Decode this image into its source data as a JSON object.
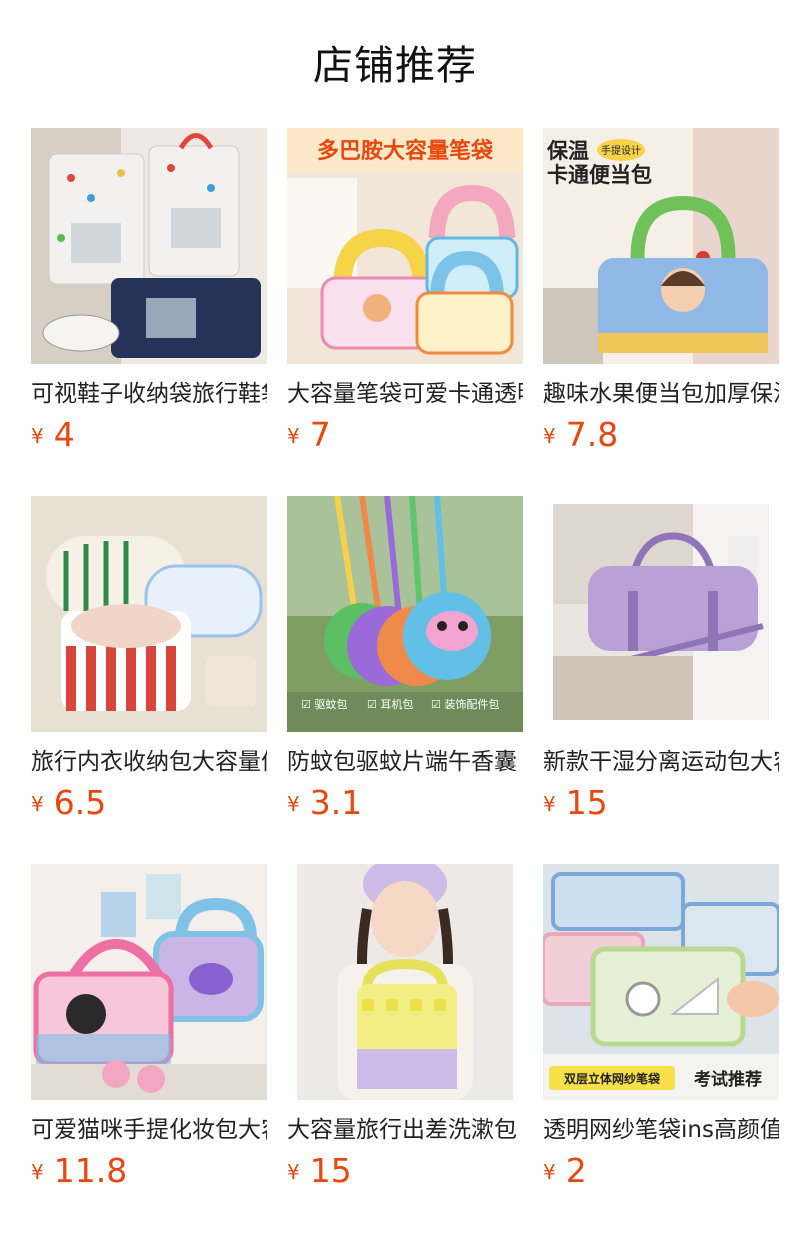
{
  "header": {
    "title": "店铺推荐"
  },
  "currency_symbol": "¥",
  "products": [
    {
      "name": "可视鞋子收纳袋旅行鞋袋",
      "price": "4",
      "image": "shoe-bag-photo",
      "colors": {
        "bg": "#eee9e3",
        "a": "#f3f1f0",
        "b": "#263257",
        "c": "#e0463c"
      }
    },
    {
      "name": "大容量笔袋可爱卡通透明",
      "price": "7",
      "image": "pencil-case-photo",
      "overlay_text": "多巴胺大容量笔袋",
      "colors": {
        "bg": "#f2e6d8",
        "a": "#f5d447",
        "b": "#f28a3a",
        "c": "#7bc3e8"
      }
    },
    {
      "name": "趣味水果便当包加厚保温",
      "price": "7.8",
      "overlay_text_1": "保温",
      "overlay_text_2": "卡通便当包",
      "overlay_badge": "手提设计",
      "image": "lunch-bag-photo",
      "colors": {
        "bg": "#efe4d8",
        "a": "#8fb8e6",
        "b": "#6fc25a",
        "c": "#f0c55a"
      }
    },
    {
      "name": "旅行内衣收纳包大容量便携",
      "price": "6.5",
      "image": "underwear-pouch-photo",
      "colors": {
        "bg": "#e9e0d4",
        "a": "#d8463b",
        "b": "#2f8a4a",
        "c": "#9cc3ee"
      }
    },
    {
      "name": "防蚊包驱蚊片端午香囊",
      "price": "3.1",
      "overlay_labels": [
        "驱蚊包",
        "耳机包",
        "装饰配件包"
      ],
      "image": "mosquito-pouch-photo",
      "colors": {
        "bg": "#7f9e63",
        "a": "#f5d04e",
        "b": "#9b6ad9",
        "c": "#62c0e8"
      }
    },
    {
      "name": "新款干湿分离运动包大容量",
      "price": "15",
      "image": "gym-bag-photo",
      "colors": {
        "bg": "#e9e6e2",
        "a": "#b9a1d6",
        "b": "#8f74b8",
        "c": "#f5f3f1"
      }
    },
    {
      "name": "可爱猫咪手提化妆包大容量",
      "price": "11.8",
      "image": "cosmetic-bag-photo",
      "colors": {
        "bg": "#f0ece9",
        "a": "#ee6fa3",
        "b": "#7fc2e6",
        "c": "#c9b5e6"
      }
    },
    {
      "name": "大容量旅行出差洗漱包",
      "price": "15",
      "image": "toiletry-bag-photo",
      "colors": {
        "bg": "#ece9e6",
        "a": "#f3ee84",
        "b": "#cdbbe8",
        "c": "#f6f1ea"
      }
    },
    {
      "name": "透明网纱笔袋ins高颜值",
      "price": "2",
      "overlay_tag": "双层立体网纱笔袋",
      "overlay_text": "考试推荐",
      "image": "mesh-pencil-case-photo",
      "colors": {
        "bg": "#dde4e9",
        "a": "#b8d98f",
        "b": "#e8a8b8",
        "c": "#7aa8d8"
      }
    }
  ]
}
